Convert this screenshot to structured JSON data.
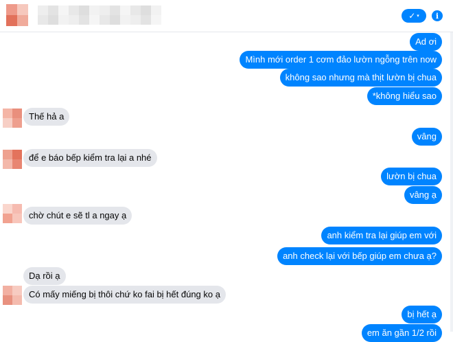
{
  "header": {
    "avatar_colors": [
      "#ee9a8a",
      "#f6c8bd",
      "#e2715b",
      "#f0ab9b"
    ],
    "name_blur_colors": [
      "#eeeeee",
      "#e3e3e3",
      "#f5f5f5",
      "#e8e8e8",
      "#dedede",
      "#f2f2f2"
    ],
    "check_icon": "✓",
    "caret_icon": "▾",
    "info_icon": "i",
    "accent": "#0084ff"
  },
  "contact_avatar_colors": [
    [
      "#f4b5a6",
      "#e98f7d",
      "#f7cfc5",
      "#ee9f8e"
    ],
    [
      "#eea18f",
      "#e3735c",
      "#f3b8aa",
      "#e88672"
    ],
    [
      "#fad6cd",
      "#f6bbb0",
      "#f1a290",
      "#f8c6bb"
    ],
    [
      "#f2b0a2",
      "#f7cbc1",
      "#e8917f",
      "#f4bbae"
    ]
  ],
  "messages": [
    {
      "dir": "out",
      "text": "Ad ơi"
    },
    {
      "dir": "out",
      "text": "Mình mới order 1 cơm đảo lườn ngỗng trên now"
    },
    {
      "dir": "out",
      "text": "không sao nhưng mà thịt lườn bị chua"
    },
    {
      "dir": "out",
      "text": "*không hiểu sao"
    },
    {
      "dir": "in",
      "text": "Thế hả a"
    },
    {
      "dir": "out",
      "text": "vâng"
    },
    {
      "dir": "in",
      "text": "để e báo bếp kiểm tra lại a nhé"
    },
    {
      "dir": "out",
      "text": "lườn bị chua"
    },
    {
      "dir": "out",
      "text": "vâng ạ"
    },
    {
      "dir": "in",
      "text": "chờ chút e sẽ tl a ngay ạ"
    },
    {
      "dir": "out",
      "text": "anh kiểm tra lại giúp em với"
    },
    {
      "dir": "out",
      "text": "anh check lại với bếp giúp em chưa ạ?"
    },
    {
      "dir": "in",
      "text": "Dạ rồi ạ"
    },
    {
      "dir": "in",
      "text": "Có mấy miếng bị thôi chứ ko fai bị hết đúng ko ạ"
    },
    {
      "dir": "out",
      "text": "bị hết ạ"
    },
    {
      "dir": "out",
      "text": "em ăn gần 1/2 rồi"
    }
  ]
}
